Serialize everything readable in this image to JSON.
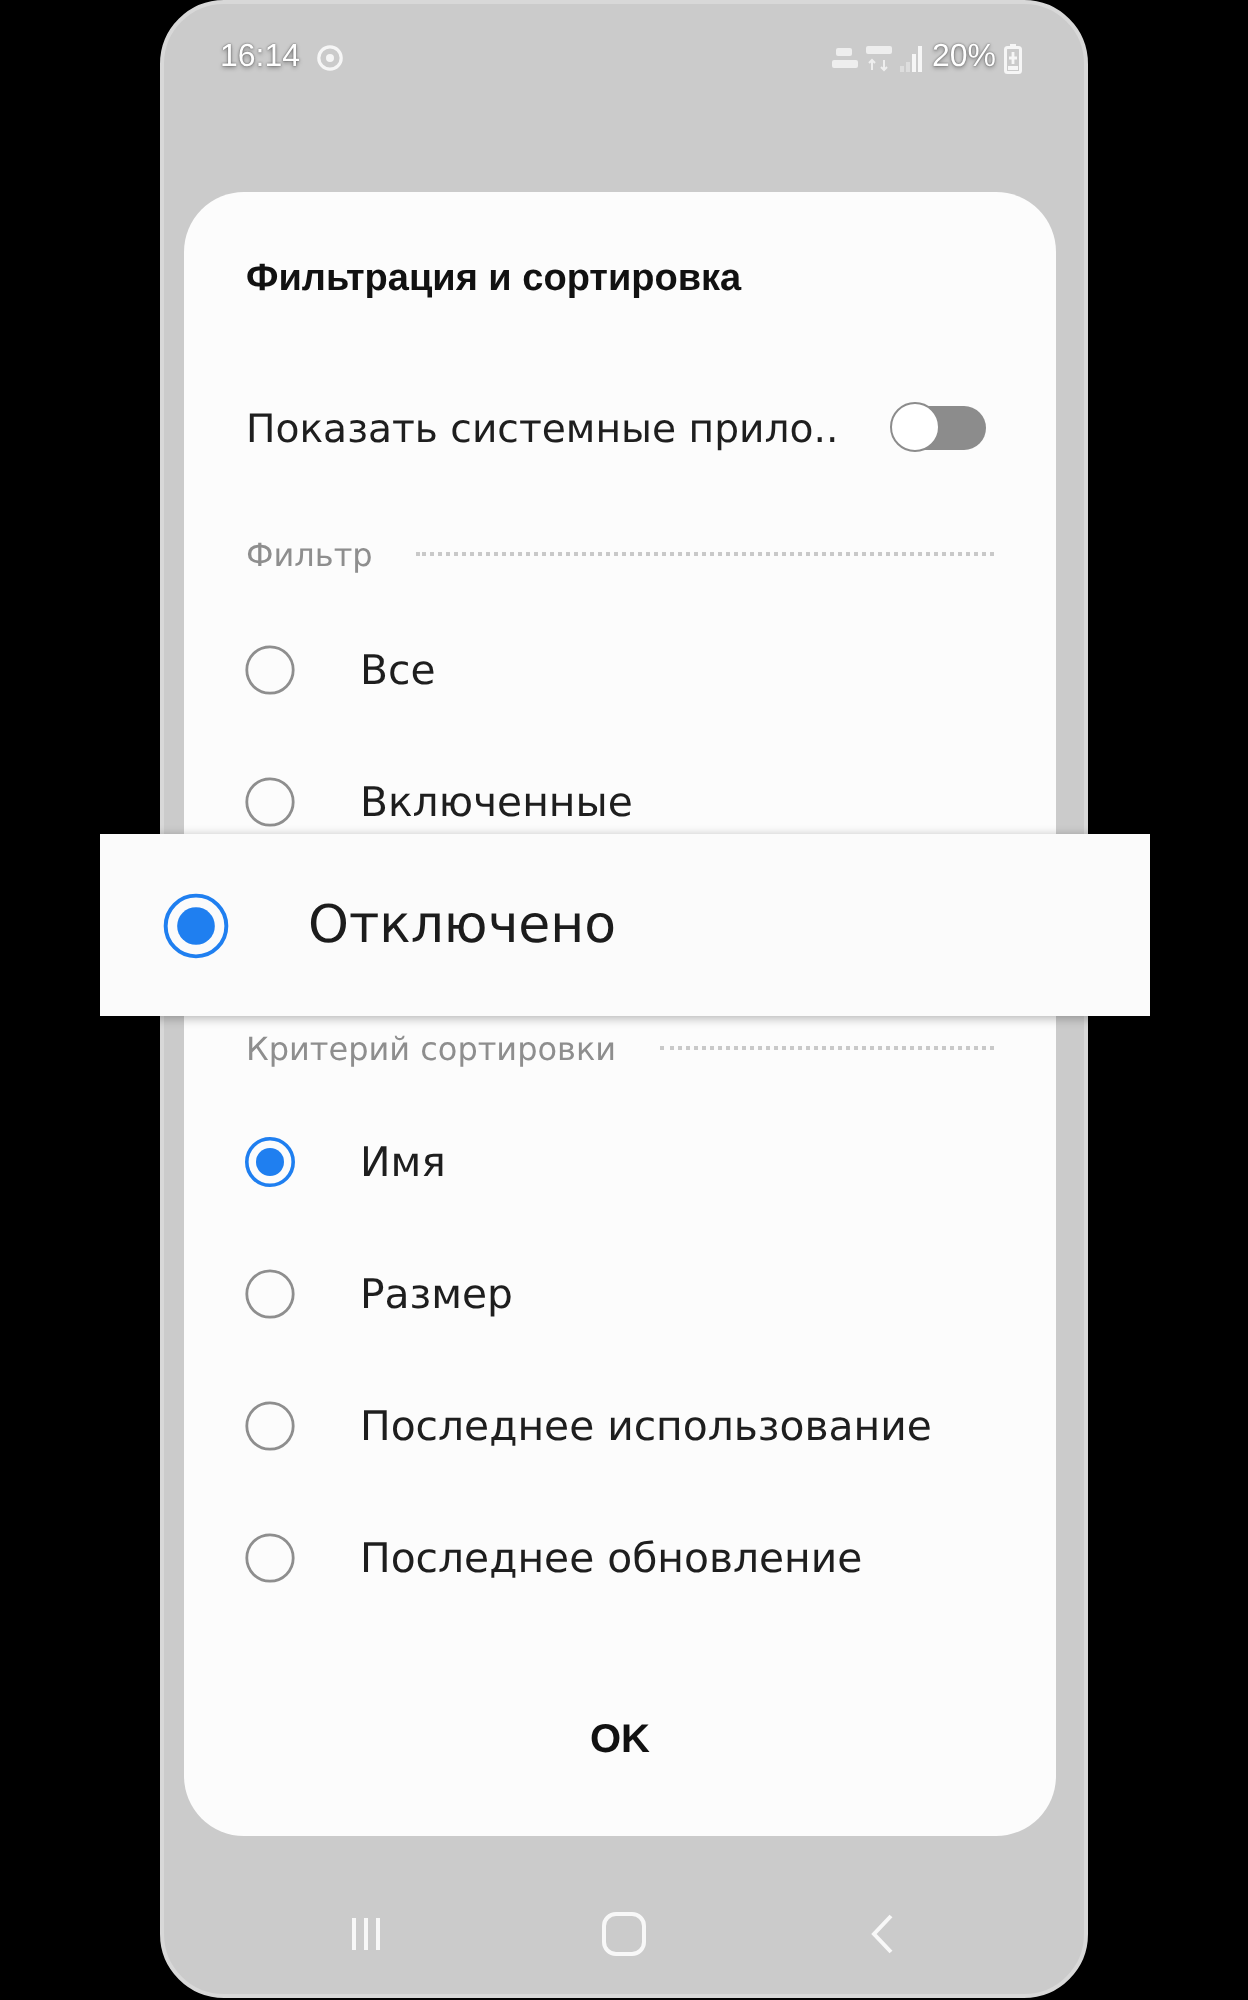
{
  "status_bar": {
    "time": "16:14",
    "battery": "20%"
  },
  "dialog": {
    "title": "Фильтрация и сортировка",
    "toggle": {
      "label": "Показать системные прило..",
      "on": false
    },
    "filter": {
      "heading": "Фильтр",
      "options": [
        {
          "label": "Все",
          "selected": false,
          "magnified": false
        },
        {
          "label": "Включенные",
          "selected": false,
          "magnified": false
        },
        {
          "label": "Отключено",
          "selected": true,
          "magnified": true
        }
      ]
    },
    "sort": {
      "heading": "Критерий сортировки",
      "options": [
        {
          "label": "Имя",
          "selected": true
        },
        {
          "label": "Размер",
          "selected": false
        },
        {
          "label": "Последнее использование",
          "selected": false
        },
        {
          "label": "Последнее обновление",
          "selected": false
        }
      ]
    },
    "buttons": [
      "OK"
    ]
  }
}
